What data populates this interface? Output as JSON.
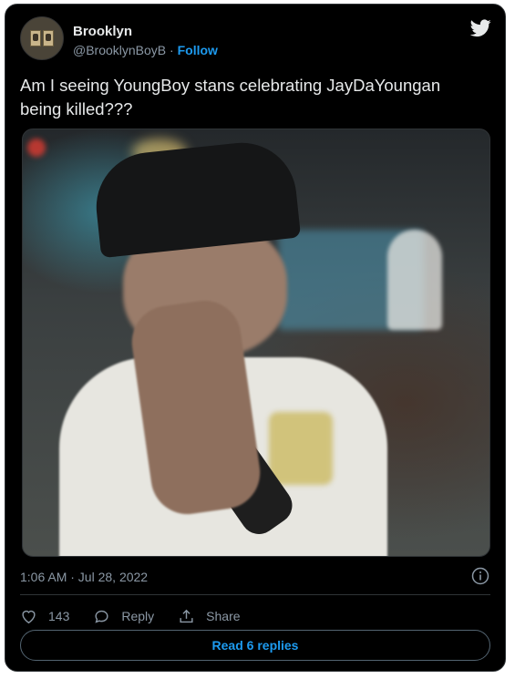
{
  "tweet": {
    "author_name": "Brooklyn",
    "author_handle": "@BrooklynBoyB",
    "separator": "·",
    "follow_label": "Follow",
    "text": "Am I seeing YoungBoy stans celebrating JayDaYoungan being killed???",
    "timestamp": "1:06 AM · Jul 28, 2022",
    "like_count": "143",
    "reply_label": "Reply",
    "share_label": "Share",
    "read_replies_label": "Read 6 replies"
  },
  "icons": {
    "brand": "twitter-bird-icon",
    "info": "info-icon",
    "like": "heart-icon",
    "reply": "speech-bubble-icon",
    "share": "share-icon"
  },
  "colors": {
    "background": "#000000",
    "accent": "#1d9bf0",
    "text_primary": "#e7e9ea",
    "text_secondary": "#8b98a5",
    "border": "#2f3336"
  }
}
